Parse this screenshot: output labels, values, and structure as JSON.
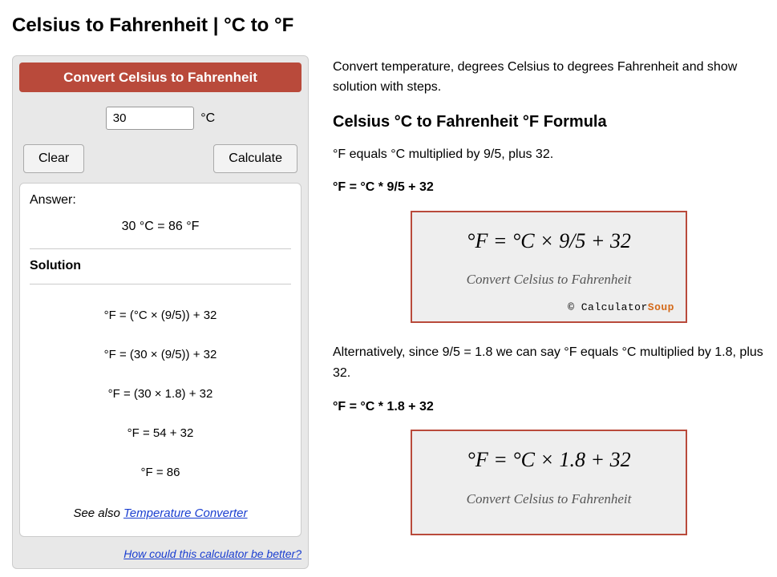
{
  "title": "Celsius to Fahrenheit | °C to °F",
  "calc": {
    "header": "Convert Celsius to Fahrenheit",
    "input_value": "30",
    "unit": "°C",
    "clear": "Clear",
    "calculate": "Calculate",
    "answer_label": "Answer:",
    "answer_value": "30 °C  =  86 °F",
    "solution_label": "Solution",
    "steps": [
      "°F = (°C × (9/5)) + 32",
      "°F = (30 × (9/5)) + 32",
      "°F = (30 × 1.8) + 32",
      "°F = 54 + 32",
      "°F = 86"
    ],
    "see_also_prefix": "See also ",
    "see_also_link": "Temperature Converter",
    "feedback": "How could this calculator be better?"
  },
  "content": {
    "intro": "Convert temperature, degrees Celsius to degrees Fahrenheit and show solution with steps.",
    "formula_heading": "Celsius °C to Fahrenheit °F Formula",
    "formula_desc1": "°F equals °C multiplied by 9/5, plus 32.",
    "formula_eq1": "°F = °C * 9/5 + 32",
    "card1_main": "°F = °C × 9/5 + 32",
    "card1_sub": "Convert Celsius to Fahrenheit",
    "brand_prefix": "© Calculator",
    "brand_suffix": "Soup",
    "formula_desc2": "Alternatively, since 9/5 = 1.8 we can say °F equals °C multiplied by 1.8, plus 32.",
    "formula_eq2": "°F = °C * 1.8 + 32",
    "card2_main": "°F = °C × 1.8 + 32",
    "card2_sub": "Convert Celsius to Fahrenheit"
  }
}
